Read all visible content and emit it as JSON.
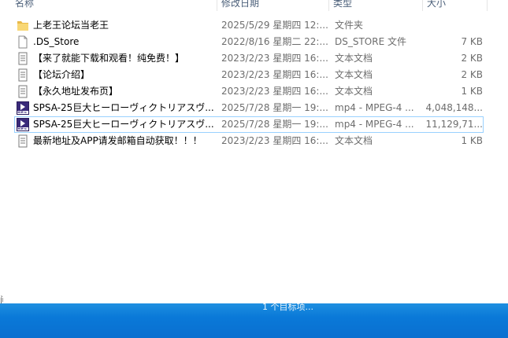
{
  "columns": {
    "name": "名称",
    "date": "修改日期",
    "type": "类型",
    "size": "大小"
  },
  "files": [
    {
      "name": "上老王论坛当老王",
      "date": "2025/5/29 星期四 12:...",
      "type": "文件夹",
      "size": "",
      "icon": "folder-icon"
    },
    {
      "name": ".DS_Store",
      "date": "2022/8/16 星期二 22:...",
      "type": "DS_STORE 文件",
      "size": "7 KB",
      "icon": "file-icon"
    },
    {
      "name": "【来了就能下载和观看！纯免费！】",
      "date": "2023/2/23 星期四 16:...",
      "type": "文本文档",
      "size": "2 KB",
      "icon": "text-document-icon"
    },
    {
      "name": "【论坛介绍】",
      "date": "2023/2/23 星期四 16:...",
      "type": "文本文档",
      "size": "2 KB",
      "icon": "text-document-icon"
    },
    {
      "name": "【永久地址发布页】",
      "date": "2023/2/23 星期四 16:...",
      "type": "文本文档",
      "size": "1 KB",
      "icon": "text-document-icon"
    },
    {
      "name": "SPSA-25巨大ヒーローヴィクトリアスヴ...",
      "date": "2025/7/28 星期一 19:...",
      "type": "mp4 - MPEG-4 ...",
      "size": "4,048,148...",
      "icon": "video-file-icon"
    },
    {
      "name": "SPSA-25巨大ヒーローヴィクトリアスヴ...",
      "date": "2025/7/28 星期一 19:...",
      "type": "mp4 - MPEG-4 ...",
      "size": "11,129,71...",
      "icon": "video-file-icon",
      "selected": true
    },
    {
      "name": "最新地址及APP请发邮箱自动获取！！！",
      "date": "2023/2/23 星期四 16:...",
      "type": "文本文档",
      "size": "1 KB",
      "icon": "text-document-icon"
    }
  ],
  "left_marker": "间",
  "taskbar_text": "1 个目标项..."
}
